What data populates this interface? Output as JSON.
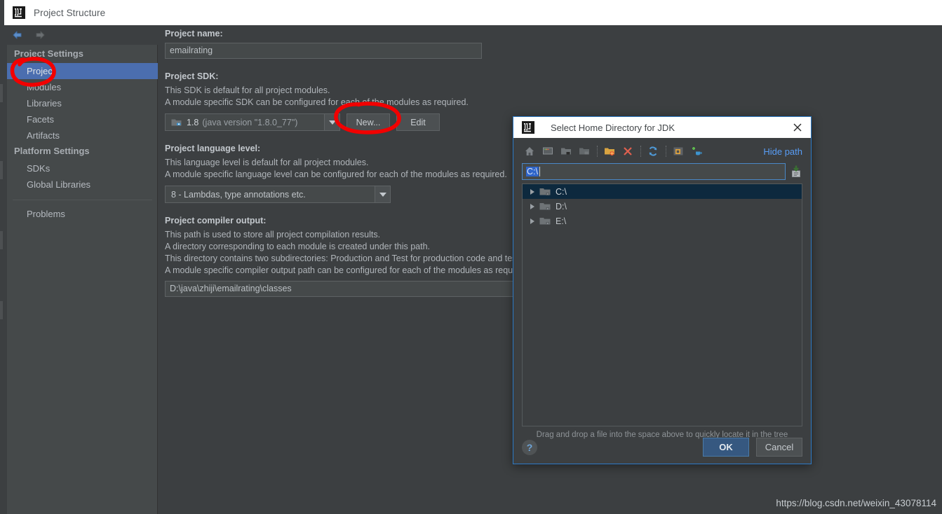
{
  "window": {
    "title": "Project Structure",
    "logo_icon": "intellij-idea-logo"
  },
  "nav": {
    "back_icon": "arrow-left-icon",
    "forward_icon": "arrow-right-icon"
  },
  "sidebar": {
    "groups": [
      {
        "header": "Project Settings",
        "items": [
          {
            "label": "Project",
            "selected": true
          },
          {
            "label": "Modules",
            "selected": false
          },
          {
            "label": "Libraries",
            "selected": false
          },
          {
            "label": "Facets",
            "selected": false
          },
          {
            "label": "Artifacts",
            "selected": false
          }
        ]
      },
      {
        "header": "Platform Settings",
        "items": [
          {
            "label": "SDKs",
            "selected": false
          },
          {
            "label": "Global Libraries",
            "selected": false
          }
        ]
      }
    ],
    "problems": {
      "label": "Problems"
    }
  },
  "main": {
    "project_name": {
      "label": "Project name:",
      "value": "emailrating"
    },
    "project_sdk": {
      "label": "Project SDK:",
      "desc_line1": "This SDK is default for all project modules.",
      "desc_line2": "A module specific SDK can be configured for each of the modules as required.",
      "selected_version": "1.8",
      "selected_detail": "(java version \"1.8.0_77\")",
      "sdk_icon": "jdk-icon",
      "new_button": "New...",
      "edit_button": "Edit"
    },
    "language_level": {
      "label": "Project language level:",
      "desc_line1": "This language level is default for all project modules.",
      "desc_line2": "A module specific language level can be configured for each of the modules as required.",
      "selected": "8 - Lambdas, type annotations etc."
    },
    "compiler_output": {
      "label": "Project compiler output:",
      "desc_line1": "This path is used to store all project compilation results.",
      "desc_line2": "A directory corresponding to each module is created under this path.",
      "desc_line3": "This directory contains two subdirectories: Production and Test for production code and test code correspondingly.",
      "desc_line4": "A module specific compiler output path can be configured for each of the modules as required.",
      "value": "D:\\java\\zhiji\\emailrating\\classes"
    }
  },
  "dialog": {
    "title": "Select Home Directory for JDK",
    "logo_icon": "intellij-idea-logo",
    "close_icon": "close-icon",
    "toolbar": [
      {
        "name": "home-icon",
        "title": "Home"
      },
      {
        "name": "desktop-icon",
        "title": "Desktop"
      },
      {
        "name": "expand-folder-icon",
        "title": "Expand All"
      },
      {
        "name": "collapse-folder-icon",
        "title": "Collapse All"
      },
      {
        "name": "new-folder-icon",
        "title": "New Folder"
      },
      {
        "name": "delete-icon",
        "title": "Delete"
      },
      {
        "name": "refresh-icon",
        "title": "Refresh"
      },
      {
        "name": "show-hidden-files-icon",
        "title": "Show Hidden Files"
      },
      {
        "name": "add-jdk-icon",
        "title": "Add JDK"
      }
    ],
    "hide_path_label": "Hide path",
    "path_value": "C:\\",
    "path_button_icon": "paste-path-icon",
    "tree": [
      {
        "label": "C:\\",
        "selected": true,
        "folder_icon": "drive-folder-icon",
        "toggle_icon": "chevron-right-icon"
      },
      {
        "label": "D:\\",
        "selected": false,
        "folder_icon": "drive-folder-icon",
        "toggle_icon": "chevron-right-icon"
      },
      {
        "label": "E:\\",
        "selected": false,
        "folder_icon": "drive-folder-icon",
        "toggle_icon": "chevron-right-icon"
      }
    ],
    "drag_hint": "Drag and drop a file into the space above to quickly locate it in the tree",
    "help_label": "?",
    "ok_label": "OK",
    "cancel_label": "Cancel"
  },
  "watermark": {
    "text": "https://blog.csdn.net/weixin_43078114"
  },
  "colors": {
    "background": "#3c3f41",
    "sidebar": "#45494a",
    "selection_blue": "#4b6eaf",
    "tree_selection": "#0d293e",
    "link_blue": "#589df6",
    "primary_button": "#365880",
    "dialog_border": "#2d7ac7",
    "annotation_red": "#f20000"
  }
}
